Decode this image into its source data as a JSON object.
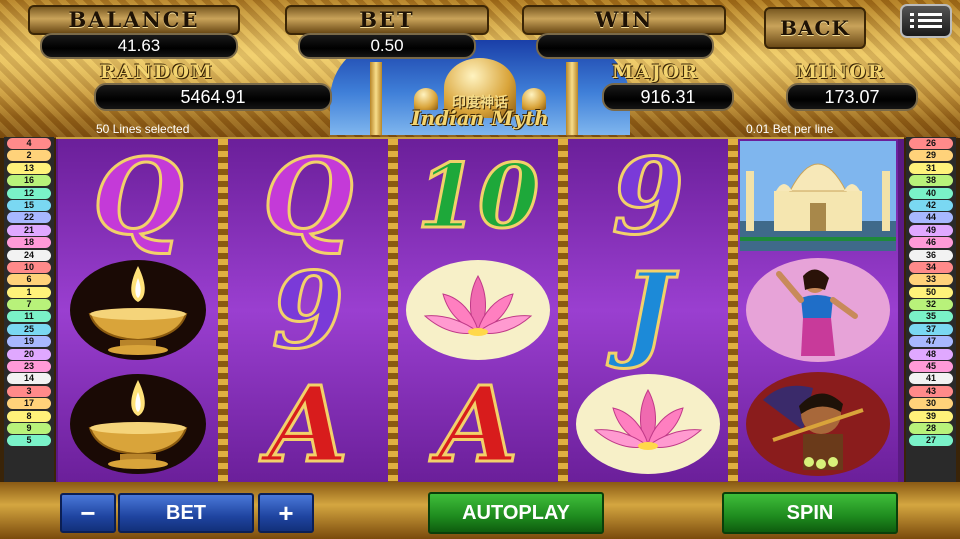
{
  "header": {
    "balance_label": "BALANCE",
    "balance_value": "41.63",
    "bet_label": "BET",
    "bet_value": "0.50",
    "win_label": "WIN",
    "win_value": "",
    "back_label": "BACK",
    "random_jackpot_label": "RANDOM JACKPOT",
    "random_jackpot_value": "5464.91",
    "major_label": "MAJOR",
    "major_value": "916.31",
    "minor_label": "MINOR",
    "minor_value": "173.07",
    "logo_chinese": "印度神话",
    "logo_english": "Indian Myth",
    "lines_selected": "50 Lines selected",
    "bet_per_line": "0.01 Bet per line"
  },
  "left_lines": [
    "4",
    "2",
    "13",
    "16",
    "12",
    "15",
    "22",
    "21",
    "18",
    "24",
    "10",
    "6",
    "1",
    "7",
    "11",
    "25",
    "19",
    "20",
    "23",
    "14",
    "3",
    "17",
    "8",
    "9",
    "5"
  ],
  "right_lines": [
    "26",
    "29",
    "31",
    "38",
    "40",
    "42",
    "44",
    "49",
    "46",
    "36",
    "34",
    "33",
    "50",
    "32",
    "35",
    "37",
    "47",
    "48",
    "45",
    "41",
    "43",
    "30",
    "39",
    "28",
    "27"
  ],
  "line_colors": [
    "#ff8a8a",
    "#ffd27a",
    "#fff27a",
    "#b8f27a",
    "#7af2c8",
    "#7ad8f2",
    "#a8b8ff",
    "#e0a8ff",
    "#ff9ad8",
    "#f2f2f2"
  ],
  "reels": [
    [
      {
        "type": "letter",
        "text": "Q",
        "color": "#c43ad8"
      },
      {
        "type": "icon",
        "icon": "diya-lamp-icon"
      },
      {
        "type": "icon",
        "icon": "diya-lamp-icon"
      }
    ],
    [
      {
        "type": "letter",
        "text": "Q",
        "color": "#c43ad8"
      },
      {
        "type": "letter",
        "text": "9",
        "color": "#7a3ad8"
      },
      {
        "type": "letter",
        "text": "A",
        "color": "#d81c1c"
      }
    ],
    [
      {
        "type": "letter",
        "text": "10",
        "color": "#1ea83a"
      },
      {
        "type": "icon",
        "icon": "lotus-flower-icon"
      },
      {
        "type": "letter",
        "text": "A",
        "color": "#d81c1c"
      }
    ],
    [
      {
        "type": "letter",
        "text": "9",
        "color": "#7a3ad8"
      },
      {
        "type": "letter",
        "text": "J",
        "color": "#1c8ad8"
      },
      {
        "type": "icon",
        "icon": "lotus-flower-icon"
      }
    ],
    [
      {
        "type": "icon",
        "icon": "taj-mahal-icon"
      },
      {
        "type": "icon",
        "icon": "dancer-icon"
      },
      {
        "type": "icon",
        "icon": "warrior-icon"
      }
    ]
  ],
  "controls": {
    "minus": "−",
    "bet": "BET",
    "plus": "+",
    "autoplay": "AUTOPLAY",
    "spin": "SPIN"
  },
  "menu_icon": "hamburger-menu-icon"
}
